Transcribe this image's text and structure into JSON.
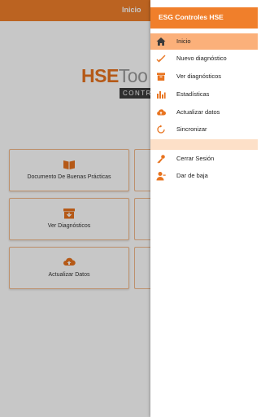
{
  "topbar": {
    "title": "Inicio"
  },
  "logo": {
    "brand": "HSE",
    "brand_rest": "Too",
    "sub": "CONTROLES"
  },
  "cards": [
    {
      "label": "Documento De Buenas Prácticas",
      "icon": "book-icon"
    },
    {
      "label": "Ver Diagnósticos",
      "icon": "archive-icon"
    },
    {
      "label": "Actualizar Datos",
      "icon": "cloud-upload-icon"
    }
  ],
  "drawer": {
    "title": "ESG Controles HSE",
    "items": [
      {
        "label": "Inicio",
        "icon": "home-icon"
      },
      {
        "label": "Nuevo diagnóstico",
        "icon": "checkmark-icon"
      },
      {
        "label": "Ver diagnósticos",
        "icon": "archive-icon"
      },
      {
        "label": "Estadísticas",
        "icon": "bar-chart-icon"
      },
      {
        "label": "Actualizar datos",
        "icon": "cloud-upload-icon"
      },
      {
        "label": "Sincronizar",
        "icon": "sync-icon"
      },
      {
        "label": "Cerrar Sesión",
        "icon": "key-icon"
      },
      {
        "label": "Dar de baja",
        "icon": "user-remove-icon"
      }
    ]
  },
  "colors": {
    "accent": "#f07f2b",
    "active": "#fbb07a",
    "band": "#fde0c8"
  }
}
